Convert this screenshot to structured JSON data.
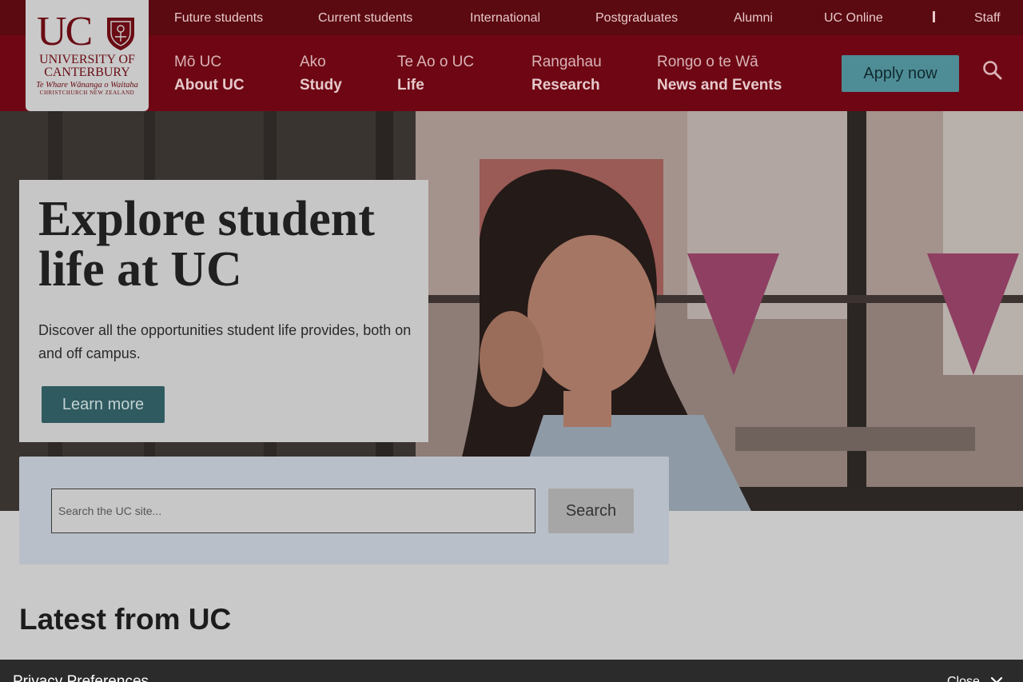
{
  "utility_nav": [
    {
      "label": "Future students"
    },
    {
      "label": "Current students"
    },
    {
      "label": "International"
    },
    {
      "label": "Postgraduates"
    },
    {
      "label": "Alumni"
    },
    {
      "label": "UC Online"
    },
    {
      "label": "Staff"
    }
  ],
  "logo": {
    "letters": "UC",
    "name_line1": "UNIVERSITY OF",
    "name_line2": "CANTERBURY",
    "maori_name": "Te Whare Wānanga o Waitaha",
    "city": "CHRISTCHURCH NEW ZEALAND"
  },
  "main_nav": [
    {
      "maori": "Mō UC",
      "english": "About UC"
    },
    {
      "maori": "Ako",
      "english": "Study"
    },
    {
      "maori": "Te Ao o UC",
      "english": "Life"
    },
    {
      "maori": "Rangahau",
      "english": "Research"
    },
    {
      "maori": "Rongo o te Wā",
      "english": "News and Events"
    }
  ],
  "apply_label": "Apply now",
  "hero": {
    "title": "Explore student life at UC",
    "description": "Discover all the opportunities student life provides, both on and off campus.",
    "cta_label": "Learn more"
  },
  "search": {
    "placeholder": "Search the UC site...",
    "button_label": "Search"
  },
  "latest_heading": "Latest from UC",
  "privacy": {
    "title": "Privacy Preferences",
    "close_label": "Close"
  },
  "colors": {
    "utility_bar": "#5a0a10",
    "main_nav": "#6e0713",
    "apply_button": "#4f8d96",
    "learn_more_button": "#2f5b60"
  }
}
